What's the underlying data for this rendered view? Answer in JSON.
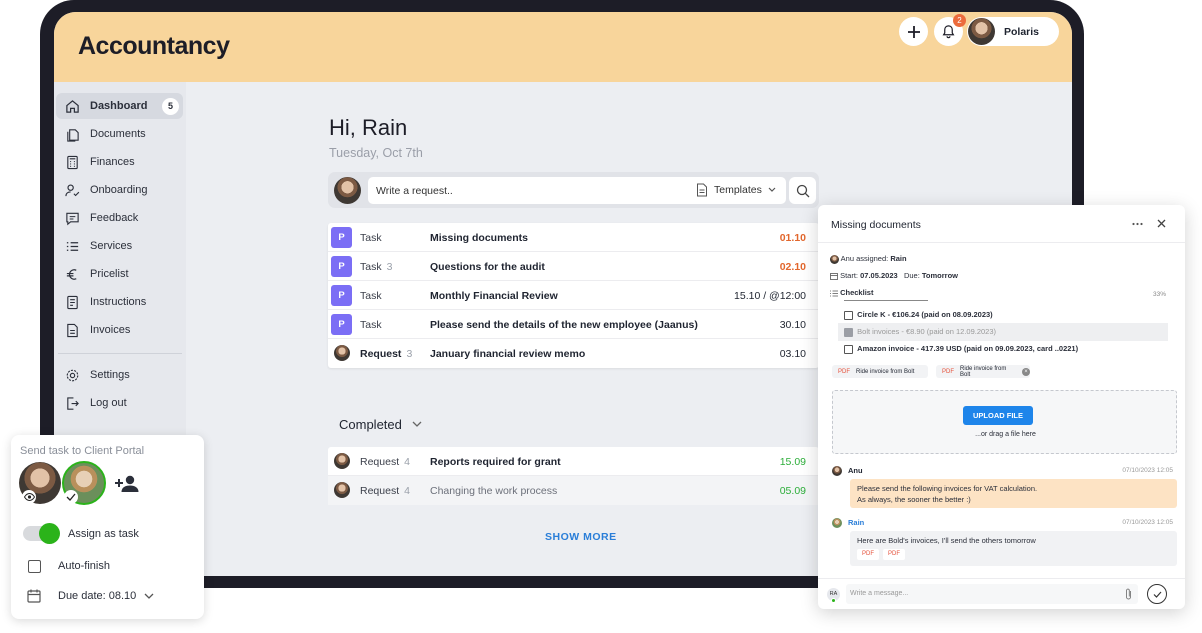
{
  "app": {
    "title": "Accountancy",
    "notification_count": "2",
    "user_name": "Polaris"
  },
  "sidebar": {
    "items": [
      {
        "label": "Dashboard",
        "badge": "5"
      },
      {
        "label": "Documents"
      },
      {
        "label": "Finances"
      },
      {
        "label": "Onboarding"
      },
      {
        "label": "Feedback"
      },
      {
        "label": "Services"
      },
      {
        "label": "Pricelist"
      },
      {
        "label": "Instructions"
      },
      {
        "label": "Invoices"
      }
    ],
    "bottom": [
      {
        "label": "Settings"
      },
      {
        "label": "Log out"
      }
    ]
  },
  "main": {
    "greeting": "Hi, Rain",
    "date": "Tuesday, Oct 7th",
    "request_placeholder": "Write a request..",
    "templates_label": "Templates",
    "tasks": [
      {
        "badge": "P",
        "type": "Task",
        "count": "",
        "title": "Missing documents",
        "due": "01.10"
      },
      {
        "badge": "P",
        "type": "Task",
        "count": "3",
        "title": "Questions for the audit",
        "due": "02.10"
      },
      {
        "badge": "P",
        "type": "Task",
        "count": "",
        "title": "Monthly Financial Review",
        "due": "15.10 / @12:00"
      },
      {
        "badge": "P",
        "type": "Task",
        "count": "",
        "title": "Please send the details of the new employee (Jaanus)",
        "due": "30.10"
      },
      {
        "badge": "",
        "type": "Request",
        "count": "3",
        "title": "January financial review memo",
        "due": "03.10"
      }
    ],
    "completed_label": "Completed",
    "completed": [
      {
        "type": "Request",
        "count": "4",
        "title": "Reports required for grant",
        "due": "15.09"
      },
      {
        "type": "Request",
        "count": "4",
        "title": "Changing the work process",
        "due": "05.09"
      }
    ],
    "show_more": "SHOW MORE"
  },
  "panel": {
    "title": "Missing documents",
    "assigned_by": "Anu assigned:",
    "assignee": "Rain",
    "start_label": "Start:",
    "start_value": "07.05.2023",
    "due_label": "Due:",
    "due_value": "Tomorrow",
    "checklist_label": "Checklist",
    "checklist_progress": "33%",
    "checklist": [
      {
        "text": "Circle K - €106.24 (paid on 08.09.2023)",
        "checked": false
      },
      {
        "text": "Bolt invoices - €8.90 (paid on 12.09.2023)",
        "checked": true
      },
      {
        "text": "Amazon invoice - 417.39 USD (paid on 09.09.2023, card ..0221)",
        "checked": false
      }
    ],
    "attachments": [
      {
        "type": "PDF",
        "name": "Ride invoice from Bolt"
      },
      {
        "type": "PDF",
        "name": "Ride invoice from Bolt"
      }
    ],
    "upload_label": "UPLOAD FILE",
    "drag_label": "...or drag a file here",
    "messages": [
      {
        "author": "Anu",
        "time": "07/10/2023 12:05",
        "line1": "Please send the following invoices for VAT calculation.",
        "line2": "As always, the sooner the better :)"
      },
      {
        "author": "Rain",
        "time": "07/10/2023 12:05",
        "line1": "Here are Bold's invoices, I'll send the others tomorrow",
        "line2": ""
      }
    ],
    "message_placeholder": "Write a message...",
    "my_initials": "RA"
  },
  "portal": {
    "title": "Send task to Client Portal",
    "assign_label": "Assign as task",
    "autofinish_label": "Auto-finish",
    "due_label": "Due date: 08.10"
  },
  "colors": {
    "header": "#f8d59b",
    "accent_purple": "#7b6ef5",
    "overdue": "#e2672d",
    "done": "#2dae3a",
    "link": "#2a7ed8",
    "toggle_on": "#2bb31a"
  }
}
